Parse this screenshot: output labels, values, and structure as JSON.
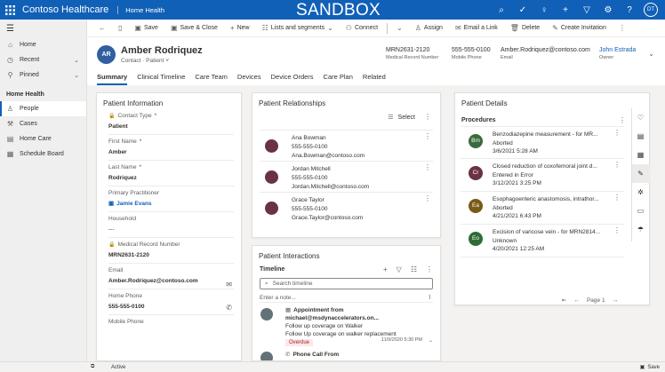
{
  "topbar": {
    "app_name": "Contoso Healthcare",
    "area_name": "Home Health",
    "env_badge": "SANDBOX",
    "user_initials": "DT"
  },
  "commands": {
    "save": "Save",
    "save_close": "Save & Close",
    "new": "New",
    "lists": "Lists and segments",
    "connect": "Connect",
    "assign": "Assign",
    "email_link": "Email a Link",
    "delete": "Delete",
    "create_invite": "Create Invitation"
  },
  "nav": {
    "home": "Home",
    "recent": "Recent",
    "pinned": "Pinned",
    "group": "Home Health",
    "people": "People",
    "cases": "Cases",
    "home_care": "Home Care",
    "schedule_board": "Schedule Board"
  },
  "header": {
    "initials": "AR",
    "name": "Amber Rodriquez",
    "subtitle": "Contact · Patient ˅",
    "mrn": "MRN2631-2120",
    "mrn_label": "Medical Record Number",
    "phone": "555-555-0100",
    "phone_label": "Mobile Phone",
    "email": "Amber.Rodriquez@contoso.com",
    "email_label": "Email",
    "owner": "John Estrada",
    "owner_label": "Owner"
  },
  "tabs": [
    "Summary",
    "Clinical Timeline",
    "Care Team",
    "Devices",
    "Device Orders",
    "Care Plan",
    "Related"
  ],
  "patient_info": {
    "title": "Patient Information",
    "contact_type_label": "Contact Type",
    "contact_type": "Patient",
    "first_name_label": "First Name",
    "first_name": "Amber",
    "last_name_label": "Last Name",
    "last_name": "Rodriquez",
    "practitioner_label": "Primary Practitioner",
    "practitioner": "Jamie Evans",
    "household_label": "Household",
    "household": "---",
    "mrn_label": "Medical Record Number",
    "mrn": "MRN2631-2120",
    "email_label": "Email",
    "email": "Amber.Rodriquez@contoso.com",
    "home_phone_label": "Home Phone",
    "home_phone": "555-555-0100",
    "mobile_phone_label": "Mobile Phone"
  },
  "relationships": {
    "title": "Patient Relationships",
    "select": "Select",
    "items": [
      {
        "name": "Ana Bowman",
        "phone": "555-555-0100",
        "email": "Ana.Bowman@contoso.com"
      },
      {
        "name": "Jordan Mitchell",
        "phone": "555-555-0100",
        "email": "Jordan.Mitchell@contoso.com"
      },
      {
        "name": "Grace Taylor",
        "phone": "555-555-0100",
        "email": "Grace.Taylor@contoso.com"
      }
    ]
  },
  "interactions": {
    "title": "Patient Interactions",
    "timeline": "Timeline",
    "search_placeholder": "Search timeline",
    "note_placeholder": "Enter a note...",
    "item": {
      "title": "Appointment from michael@msdynaccelerators.on...",
      "line1": "Follow up coverage on Walker",
      "line2": "Follow Up coverage on walker replacement",
      "badge": "Overdue",
      "date": "11/9/2020 5:30 PM"
    },
    "item2_title": "Phone Call From"
  },
  "details": {
    "title": "Patient Details",
    "procedures": "Procedures",
    "items": [
      {
        "initials": "Bm",
        "color": "#3a6b3d",
        "title": "Benzodiazepine measurement - for MR...",
        "status": "Aborted",
        "date": "3/6/2021 5:28 AM"
      },
      {
        "initials": "Cr",
        "color": "#6b3242",
        "title": "Closed reduction of coxofemoral joint d...",
        "status": "Entered in Error",
        "date": "3/12/2021 3:25 PM"
      },
      {
        "initials": "Ea",
        "color": "#7a5a16",
        "title": "Esophagoenteric anastomosis, intrathor...",
        "status": "Aborted",
        "date": "4/21/2021 6:43 PM"
      },
      {
        "initials": "Eo",
        "color": "#2e6d36",
        "title": "Excision of varicose vein - for MRN2814...",
        "status": "Unknown",
        "date": "4/20/2021 12:25 AM"
      }
    ],
    "page": "Page 1"
  },
  "status": {
    "state": "Active",
    "save": "Save"
  }
}
